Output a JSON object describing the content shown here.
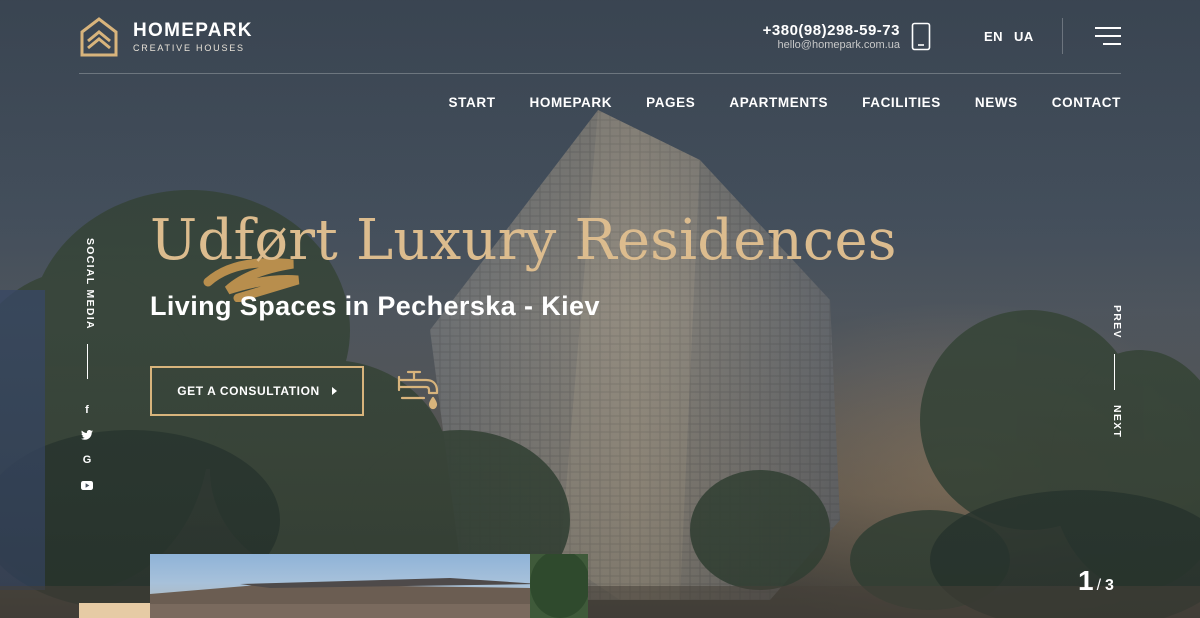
{
  "logo": {
    "title": "HOMEPARK",
    "subtitle": "CREATIVE HOUSES",
    "icon": "house-logo-icon"
  },
  "contact": {
    "phone": "+380(98)298-59-73",
    "email": "hello@homepark.com.ua",
    "icon": "mobile-phone-icon"
  },
  "languages": [
    "EN",
    "UA"
  ],
  "menu_icon": "hamburger-menu-icon",
  "nav": [
    "START",
    "HOMEPARK",
    "PAGES",
    "APARTMENTS",
    "FACILITIES",
    "NEWS",
    "CONTACT"
  ],
  "hero": {
    "headline": "Udført Luxury Residences",
    "subline": "Living Spaces in Pecherska - Kiev",
    "cta_label": "GET A CONSULTATION",
    "feature_icon": "faucet-icon"
  },
  "social": {
    "label": "SOCIAL MEDIA",
    "links": [
      {
        "name": "facebook-icon",
        "glyph": "f"
      },
      {
        "name": "twitter-icon",
        "glyph": ""
      },
      {
        "name": "google-icon",
        "glyph": "G"
      },
      {
        "name": "youtube-icon",
        "glyph": ""
      }
    ]
  },
  "slider": {
    "prev_label": "PREV",
    "next_label": "NEXT",
    "current": "1",
    "total": "3"
  },
  "colors": {
    "accent": "#dcbc8e",
    "cta_border": "#d8b47c",
    "bottom_accent": "#e6cba5"
  }
}
